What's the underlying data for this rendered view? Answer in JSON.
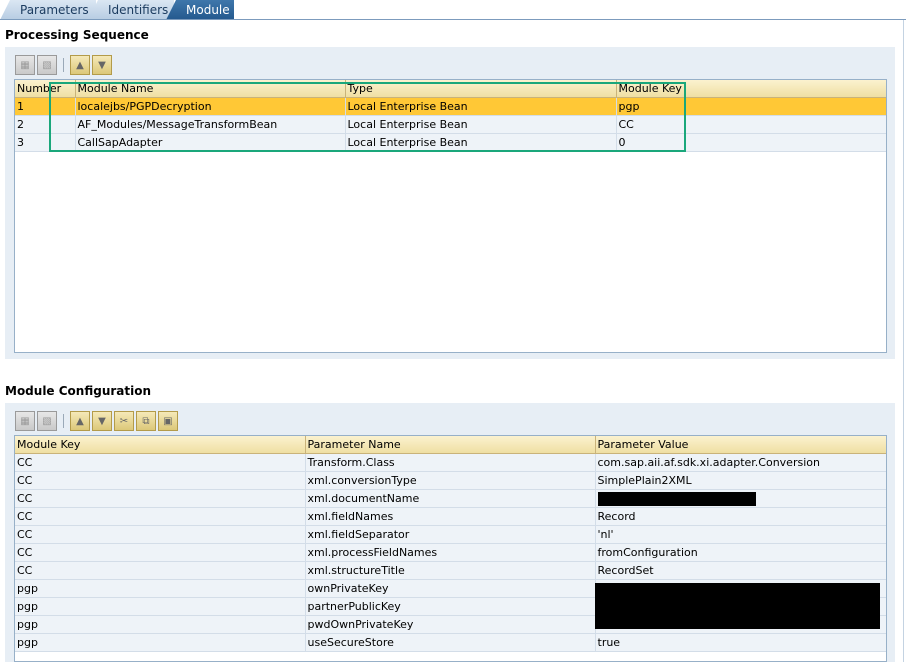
{
  "tabs": [
    {
      "label": "Parameters"
    },
    {
      "label": "Identifiers"
    },
    {
      "label": "Module"
    }
  ],
  "processing": {
    "title": "Processing Sequence",
    "columns": [
      "Number",
      "Module Name",
      "Type",
      "Module Key"
    ],
    "rows": [
      {
        "number": "1",
        "module_name": "localejbs/PGPDecryption",
        "type": "Local Enterprise Bean",
        "module_key": "pgp"
      },
      {
        "number": "2",
        "module_name": "AF_Modules/MessageTransformBean",
        "type": "Local Enterprise Bean",
        "module_key": "CC"
      },
      {
        "number": "3",
        "module_name": "CallSapAdapter",
        "type": "Local Enterprise Bean",
        "module_key": "0"
      }
    ],
    "toolbar_icons": [
      "insert-row-icon",
      "delete-row-icon",
      "move-up-icon",
      "move-down-icon"
    ]
  },
  "config": {
    "title": "Module Configuration",
    "columns": [
      "Module Key",
      "Parameter Name",
      "Parameter Value"
    ],
    "rows": [
      {
        "module_key": "CC",
        "param_name": "Transform.Class",
        "param_value": "com.sap.aii.af.sdk.xi.adapter.Conversion"
      },
      {
        "module_key": "CC",
        "param_name": "xml.conversionType",
        "param_value": "SimplePlain2XML"
      },
      {
        "module_key": "CC",
        "param_name": "xml.documentName",
        "param_value": ""
      },
      {
        "module_key": "CC",
        "param_name": "xml.fieldNames",
        "param_value": "Record"
      },
      {
        "module_key": "CC",
        "param_name": "xml.fieldSeparator",
        "param_value": "'nl'"
      },
      {
        "module_key": "CC",
        "param_name": "xml.processFieldNames",
        "param_value": "fromConfiguration"
      },
      {
        "module_key": "CC",
        "param_name": "xml.structureTitle",
        "param_value": "RecordSet"
      },
      {
        "module_key": "pgp",
        "param_name": "ownPrivateKey",
        "param_value": ""
      },
      {
        "module_key": "pgp",
        "param_name": "partnerPublicKey",
        "param_value": ""
      },
      {
        "module_key": "pgp",
        "param_name": "pwdOwnPrivateKey",
        "param_value": ""
      },
      {
        "module_key": "pgp",
        "param_name": "useSecureStore",
        "param_value": "true"
      }
    ],
    "toolbar_icons": [
      "insert-row-icon",
      "delete-row-icon",
      "move-up-icon",
      "move-down-icon",
      "cut-icon",
      "copy-icon",
      "paste-icon"
    ]
  },
  "colors": {
    "selected_row": "#ffc836",
    "highlight_box": "#1aa77b",
    "active_tab": "#255a8f"
  }
}
